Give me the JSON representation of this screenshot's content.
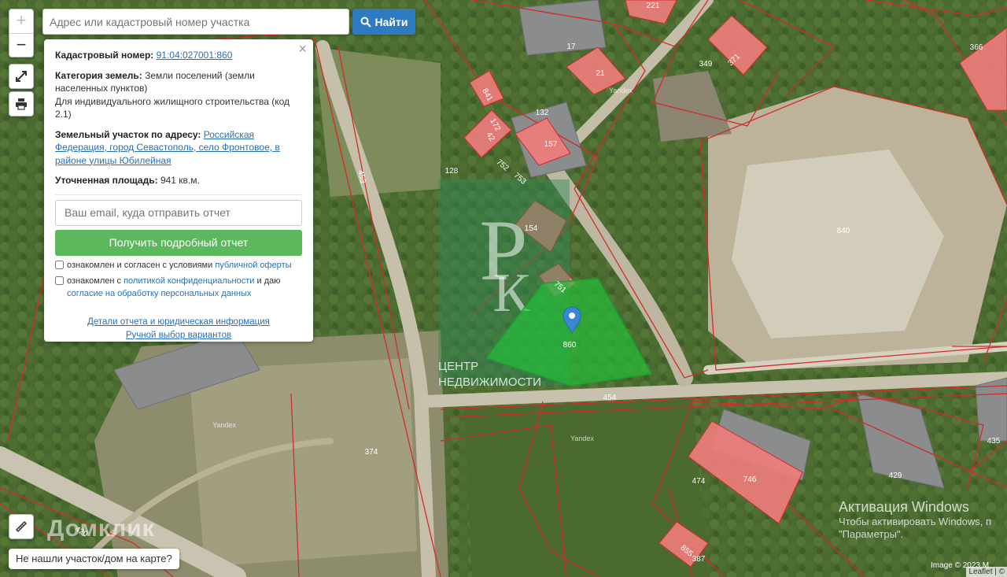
{
  "search": {
    "placeholder": "Адрес или кадастровый номер участка",
    "button_label": "Найти"
  },
  "zoom": {
    "in_label": "+",
    "out_label": "−"
  },
  "icons": {
    "fullscreen": "expand-arrows-icon",
    "print": "printer-icon",
    "ruler": "ruler-icon",
    "search": "magnifier-icon",
    "marker": "map-pin-icon"
  },
  "info": {
    "close_label": "×",
    "cadastral_label": "Кадастровый номер:",
    "cadastral_value": "91:04:027001:860",
    "category_label": "Категория земель:",
    "category_value": "Земли поселений (земли населенных пунктов)",
    "usage_value": "Для индивидуального жилищного строительства (код 2.1)",
    "address_label": "Земельный участок по адресу:",
    "address_value": "Российская Федерация, город Севастополь, село Фронтовое, в районе улицы Юбилейная",
    "area_label": "Уточненная площадь:",
    "area_value": "941 кв.м.",
    "email_placeholder": "Ваш email, куда отправить отчет",
    "report_button": "Получить подробный отчет",
    "consent1_text": "ознакомлен и согласен с условиями",
    "consent1_link": "публичной оферты",
    "consent2_text": "ознакомлен с",
    "consent2_link": "политикой конфиденциальности",
    "consent2_mid": "и даю",
    "consent2_link2": "согласие на обработку персональных данных",
    "details_link": "Детали отчета и юридическая информация",
    "manual_link": "Ручной выбор вариантов"
  },
  "map": {
    "selected_parcel": "860",
    "selected_color": "#22c33a",
    "parcel_fill": "#ef7c7c",
    "boundary_color": "#d42b2b",
    "parcel_labels": [
      "221",
      "17",
      "21",
      "349",
      "371",
      "366",
      "841",
      "132",
      "172",
      "42",
      "157",
      "752",
      "753",
      "128",
      "453",
      "154",
      "751",
      "840",
      "454",
      "374",
      "474",
      "746",
      "429",
      "435",
      "420",
      "855",
      "387"
    ],
    "watermark_text": "ЦЕНТР НЕДВИЖИМОСТИ",
    "yandex_labels": [
      "Yandex",
      "Yandex",
      "Yandex"
    ]
  },
  "footer": {
    "not_found": "Не нашли участок/дом на карте?",
    "brand_watermark": "Домклик",
    "windows_title": "Активация Windows",
    "windows_sub1": "Чтобы активировать Windows, п",
    "windows_sub2": "\"Параметры\".",
    "image_credit": "Image © 2023 M",
    "attribution": "Leaflet | ©"
  }
}
